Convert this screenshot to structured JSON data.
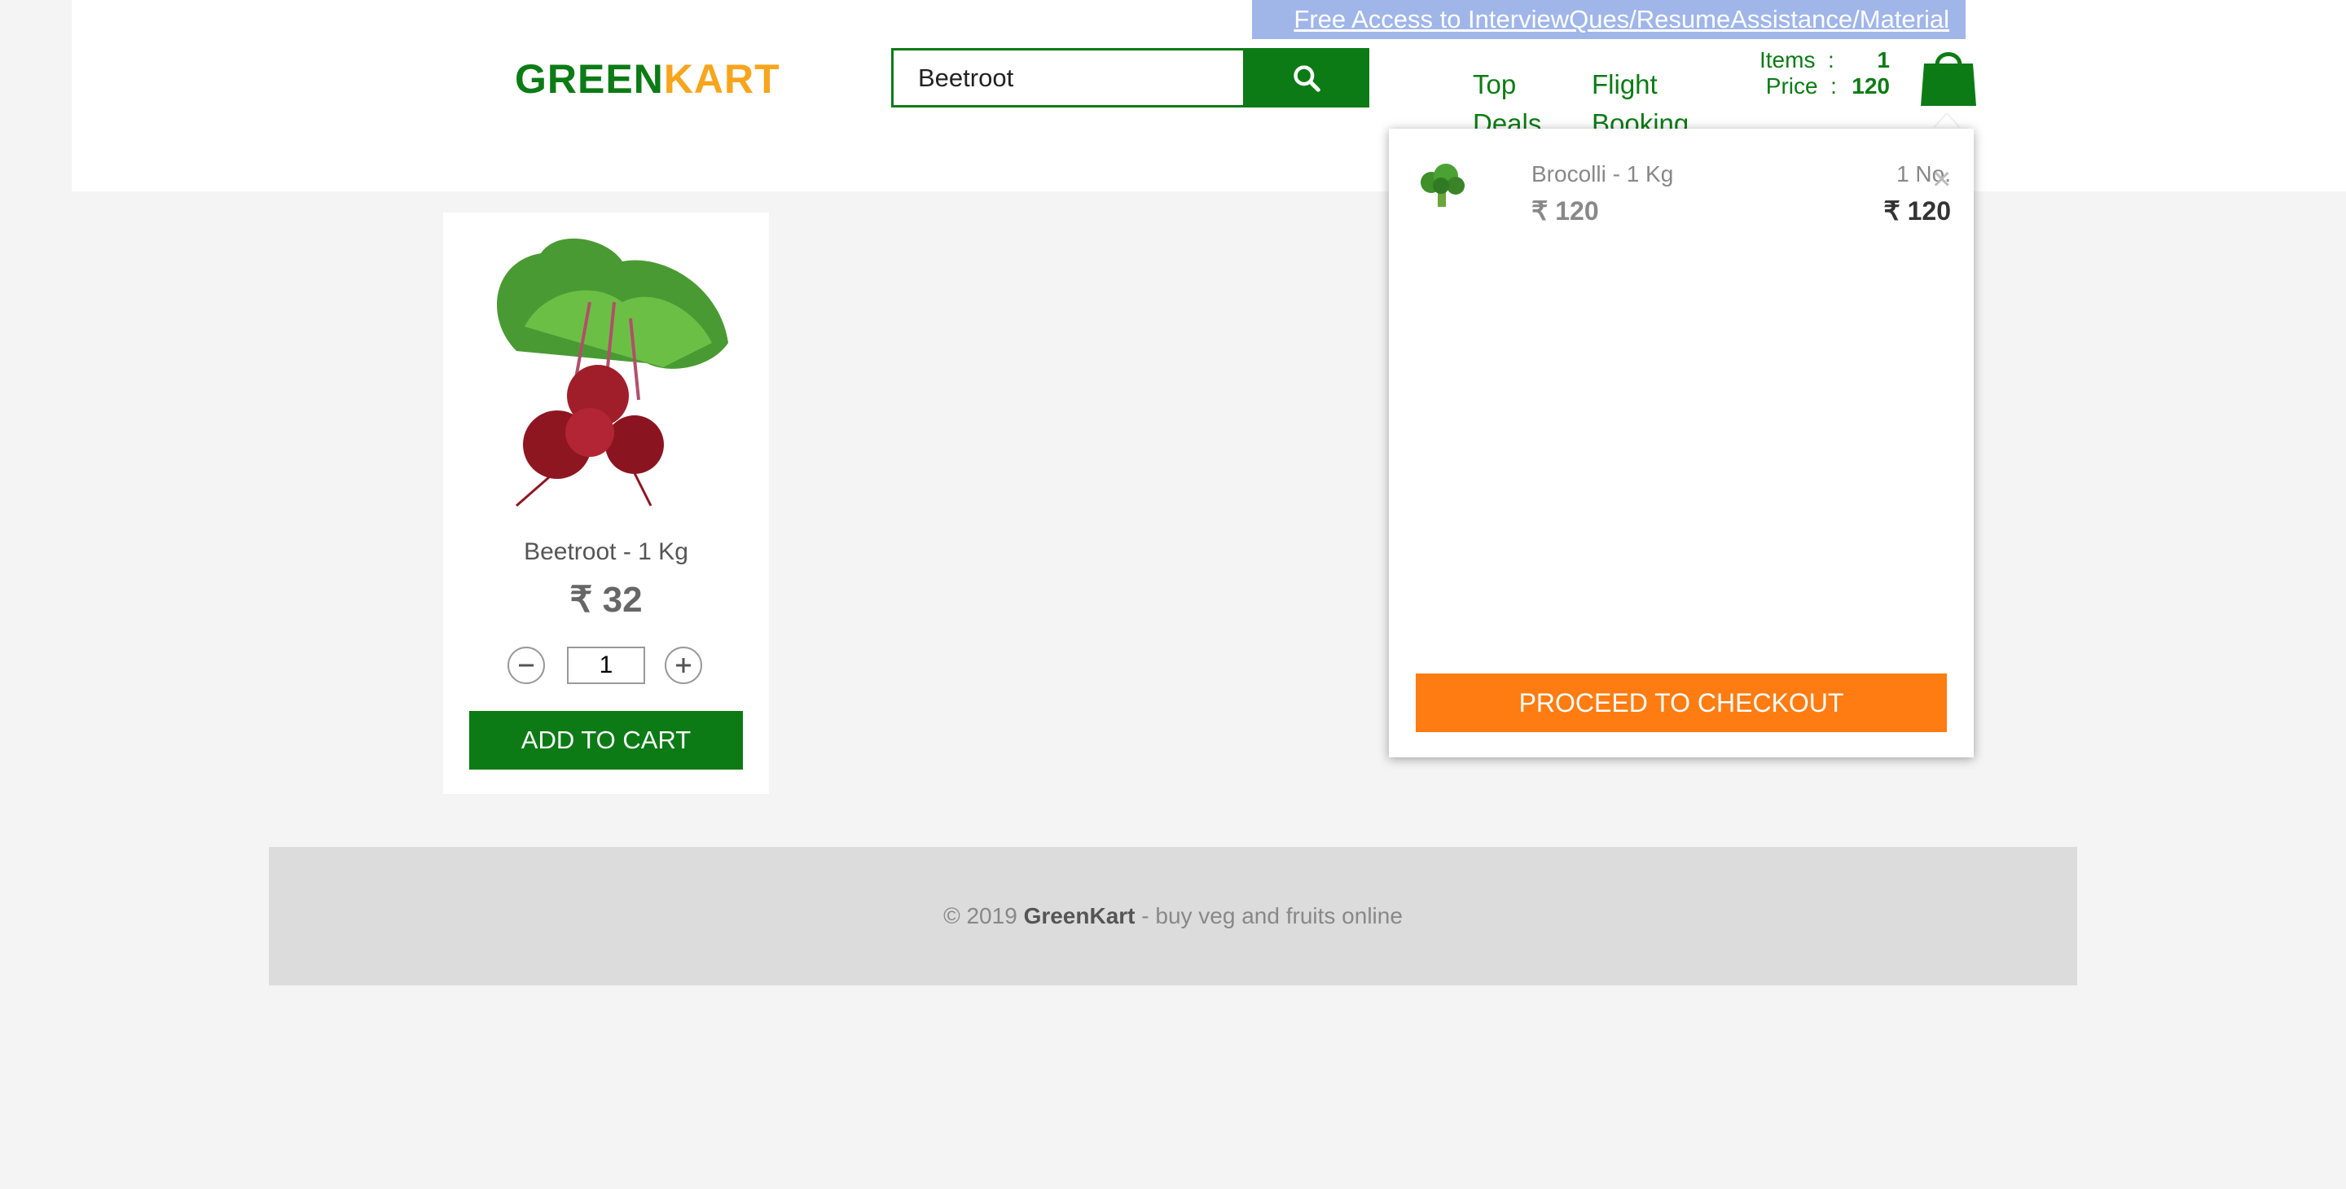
{
  "promo": {
    "text": "Free Access to InterviewQues/ResumeAssistance/Material"
  },
  "brand": {
    "part1": "GREEN",
    "part2": "KART"
  },
  "search": {
    "value": "Beetroot",
    "button_icon": "search-icon"
  },
  "nav": {
    "top_deals": "Top Deals",
    "flight_booking": "Flight Booking"
  },
  "cart_summary": {
    "items_label": "Items",
    "items_sep": ":",
    "items_value": "1",
    "price_label": "Price",
    "price_sep": ":",
    "price_value": "120",
    "icon": "shopping-bag-icon"
  },
  "cart_preview": {
    "items": [
      {
        "name": "Brocolli - 1 Kg",
        "price": "₹ 120",
        "quantity": "1 No.",
        "amount": "₹ 120",
        "image_icon": "broccoli-image"
      }
    ],
    "remove_label": "×",
    "checkout_label": "PROCEED TO CHECKOUT"
  },
  "product": {
    "name": "Beetroot - 1 Kg",
    "price": "₹ 32",
    "quantity": "1",
    "add_label": "ADD TO CART",
    "decrement_icon": "minus-icon",
    "increment_icon": "plus-icon"
  },
  "footer": {
    "copyright": "© 2019",
    "brand": "GreenKart",
    "tagline": "- buy veg and fruits online"
  },
  "colors": {
    "green": "#0c7b15",
    "orange": "#ff7c12",
    "brand_orange": "#f7a51c",
    "promo_bg": "#a0b6e9"
  }
}
